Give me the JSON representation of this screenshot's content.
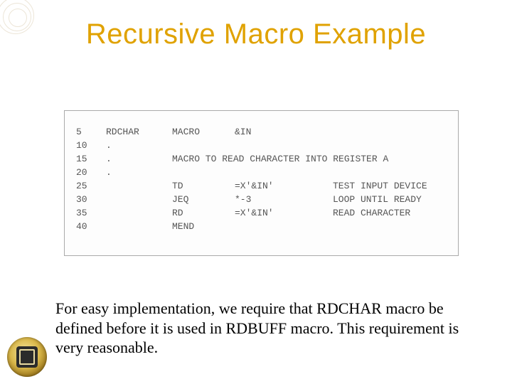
{
  "title": "Recursive Macro Example",
  "code": {
    "rows": [
      {
        "ln": "5",
        "label": "RDCHAR",
        "op": "MACRO",
        "arg": "&IN",
        "cmt": ""
      },
      {
        "ln": "10",
        "label": ".",
        "op": "",
        "arg": "",
        "cmt": ""
      },
      {
        "ln": "15",
        "label": ".",
        "op": "MACRO TO READ CHARACTER INTO REGISTER A",
        "arg": "",
        "cmt": ""
      },
      {
        "ln": "20",
        "label": ".",
        "op": "",
        "arg": "",
        "cmt": ""
      },
      {
        "ln": "25",
        "label": "",
        "op": "TD",
        "arg": "=X'&IN'",
        "cmt": "TEST INPUT DEVICE"
      },
      {
        "ln": "30",
        "label": "",
        "op": "JEQ",
        "arg": "*-3",
        "cmt": "LOOP UNTIL READY"
      },
      {
        "ln": "35",
        "label": "",
        "op": "RD",
        "arg": "=X'&IN'",
        "cmt": "READ CHARACTER"
      },
      {
        "ln": "40",
        "label": "",
        "op": "MEND",
        "arg": "",
        "cmt": ""
      }
    ]
  },
  "caption": "For easy implementation, we require that RDCHAR macro be defined before it is used in RDBUFF macro. This requirement is very reasonable."
}
